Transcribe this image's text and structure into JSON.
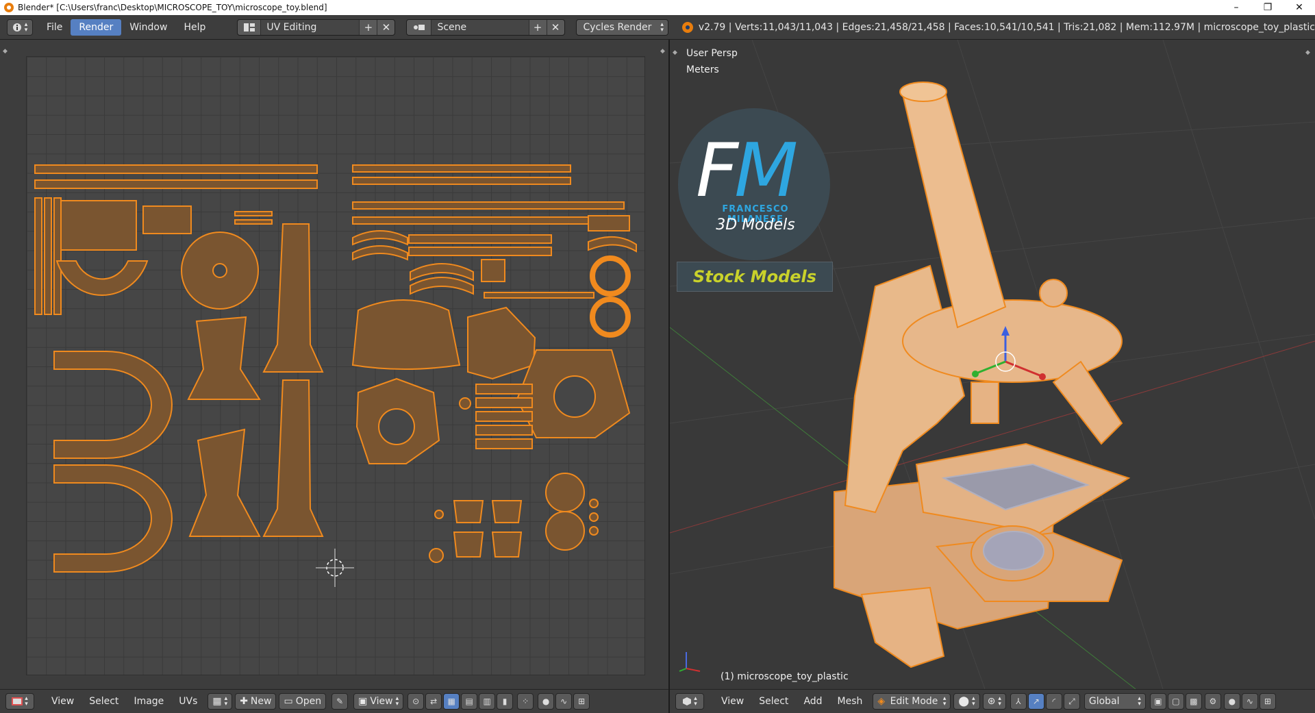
{
  "window": {
    "title": "Blender* [C:\\Users\\franc\\Desktop\\MICROSCOPE_TOY\\microscope_toy.blend]",
    "minimize": "–",
    "maximize": "❐",
    "close": "✕"
  },
  "info_header": {
    "menus": [
      "File",
      "Render",
      "Window",
      "Help"
    ],
    "active_menu": "Render",
    "screen_layout": "UV Editing",
    "scene": "Scene",
    "render_engine": "Cycles Render",
    "stats": "v2.79 | Verts:11,043/11,043 | Edges:21,458/21,458 | Faces:10,541/10,541 | Tris:21,082 | Mem:112.97M | microscope_toy_plastic"
  },
  "viewport": {
    "view_name": "User Persp",
    "units": "Meters",
    "object_label": "(1) microscope_toy_plastic"
  },
  "watermark": {
    "letters_f": "F",
    "letters_m": "M",
    "subtitle": "FRANCESCO MILANESE",
    "tagline": "3D Models",
    "stock": "Stock Models"
  },
  "uv_footer": {
    "menus": [
      "View",
      "Select",
      "Image",
      "UVs"
    ],
    "new_label": "New",
    "open_label": "Open",
    "view_label": "View"
  },
  "viewport_footer": {
    "menus": [
      "View",
      "Select",
      "Add",
      "Mesh"
    ],
    "mode": "Edit Mode",
    "orientation": "Global"
  },
  "colors": {
    "selection": "#f08a1e",
    "panel": "#3d3d3d",
    "accent": "#5680c2"
  }
}
